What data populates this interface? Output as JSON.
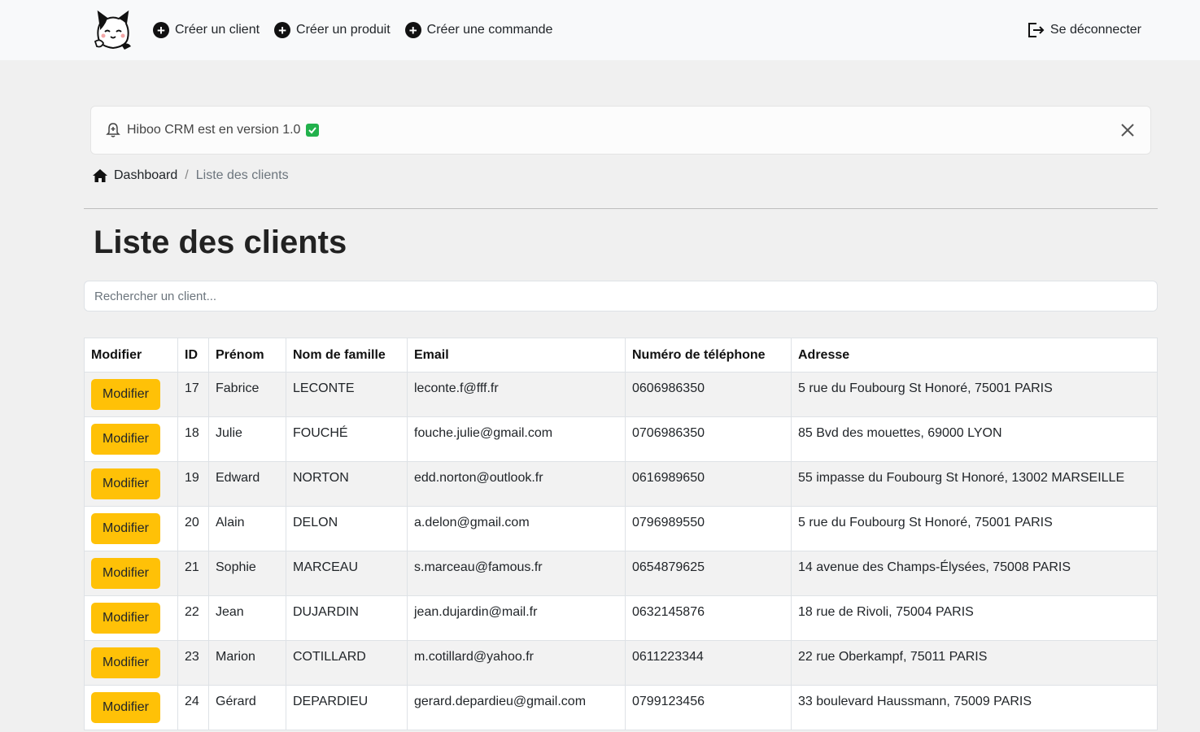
{
  "nav": {
    "links": [
      {
        "label": "Créer un client"
      },
      {
        "label": "Créer un produit"
      },
      {
        "label": "Créer une commande"
      }
    ],
    "logout_label": "Se déconnecter"
  },
  "alert": {
    "text": "Hiboo CRM est en version 1.0"
  },
  "breadcrumb": {
    "home_label": "Dashboard",
    "separator": "/",
    "current": "Liste des clients"
  },
  "page_title": "Liste des clients",
  "search": {
    "placeholder": "Rechercher un client..."
  },
  "table": {
    "headers": [
      "Modifier",
      "ID",
      "Prénom",
      "Nom de famille",
      "Email",
      "Numéro de téléphone",
      "Adresse"
    ],
    "button_label": "Modifier",
    "rows": [
      {
        "id": "17",
        "prenom": "Fabrice",
        "nom": "LECONTE",
        "email": "leconte.f@fff.fr",
        "tel": "0606986350",
        "adresse": "5 rue du Foubourg St Honoré, 75001 PARIS"
      },
      {
        "id": "18",
        "prenom": "Julie",
        "nom": "FOUCHÉ",
        "email": "fouche.julie@gmail.com",
        "tel": "0706986350",
        "adresse": "85 Bvd des mouettes, 69000 LYON"
      },
      {
        "id": "19",
        "prenom": "Edward",
        "nom": "NORTON",
        "email": "edd.norton@outlook.fr",
        "tel": "0616989650",
        "adresse": "55 impasse du Foubourg St Honoré, 13002 MARSEILLE"
      },
      {
        "id": "20",
        "prenom": "Alain",
        "nom": "DELON",
        "email": "a.delon@gmail.com",
        "tel": "0796989550",
        "adresse": "5 rue du Foubourg St Honoré, 75001 PARIS"
      },
      {
        "id": "21",
        "prenom": "Sophie",
        "nom": "MARCEAU",
        "email": "s.marceau@famous.fr",
        "tel": "0654879625",
        "adresse": "14 avenue des Champs-Élysées, 75008 PARIS"
      },
      {
        "id": "22",
        "prenom": "Jean",
        "nom": "DUJARDIN",
        "email": "jean.dujardin@mail.fr",
        "tel": "0632145876",
        "adresse": "18 rue de Rivoli, 75004 PARIS"
      },
      {
        "id": "23",
        "prenom": "Marion",
        "nom": "COTILLARD",
        "email": "m.cotillard@yahoo.fr",
        "tel": "0611223344",
        "adresse": "22 rue Oberkampf, 75011 PARIS"
      },
      {
        "id": "24",
        "prenom": "Gérard",
        "nom": "DEPARDIEU",
        "email": "gerard.depardieu@gmail.com",
        "tel": "0799123456",
        "adresse": "33 boulevard Haussmann, 75009 PARIS"
      }
    ]
  }
}
